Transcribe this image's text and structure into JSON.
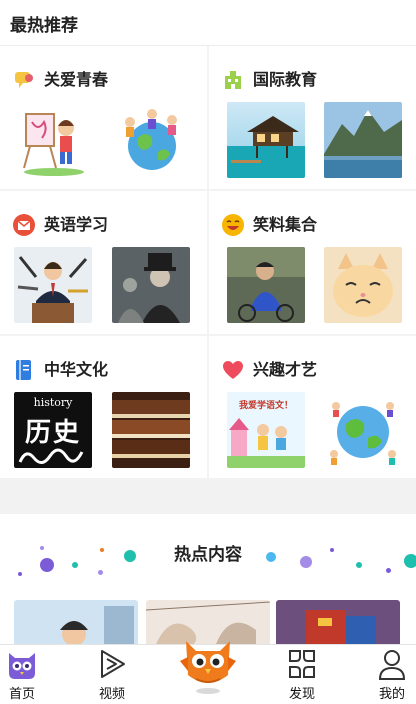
{
  "header": {
    "title": "最热推荐"
  },
  "categories": [
    {
      "label": "关爱青春",
      "icon": "chat-bubble-icon",
      "icon_color": "#f5c542"
    },
    {
      "label": "国际教育",
      "icon": "building-icon",
      "icon_color": "#9ad04a"
    },
    {
      "label": "英语学习",
      "icon": "envelope-icon",
      "icon_color": "#e8503a"
    },
    {
      "label": "笑料集合",
      "icon": "laughing-face-icon",
      "icon_color": "#f7b500"
    },
    {
      "label": "中华文化",
      "icon": "book-icon",
      "icon_color": "#2f7de1"
    },
    {
      "label": "兴趣才艺",
      "icon": "heart-icon",
      "icon_color": "#ef4b5e"
    }
  ],
  "thumb_text": {
    "history_word": "history",
    "history_title": "历史",
    "poster_caption": "我爱学语文！"
  },
  "hot": {
    "title": "热点内容"
  },
  "tabbar": {
    "items": [
      {
        "label": "首页",
        "icon": "owl-home-icon"
      },
      {
        "label": "视频",
        "icon": "play-icon"
      },
      {
        "label": "",
        "icon": "orange-owl-mascot-icon"
      },
      {
        "label": "发现",
        "icon": "four-petal-discover-icon"
      },
      {
        "label": "我的",
        "icon": "person-icon"
      }
    ]
  },
  "colors": {
    "accent_purple": "#7b5cd6",
    "mascot_orange": "#f07b1d",
    "teal": "#1fbfae"
  }
}
